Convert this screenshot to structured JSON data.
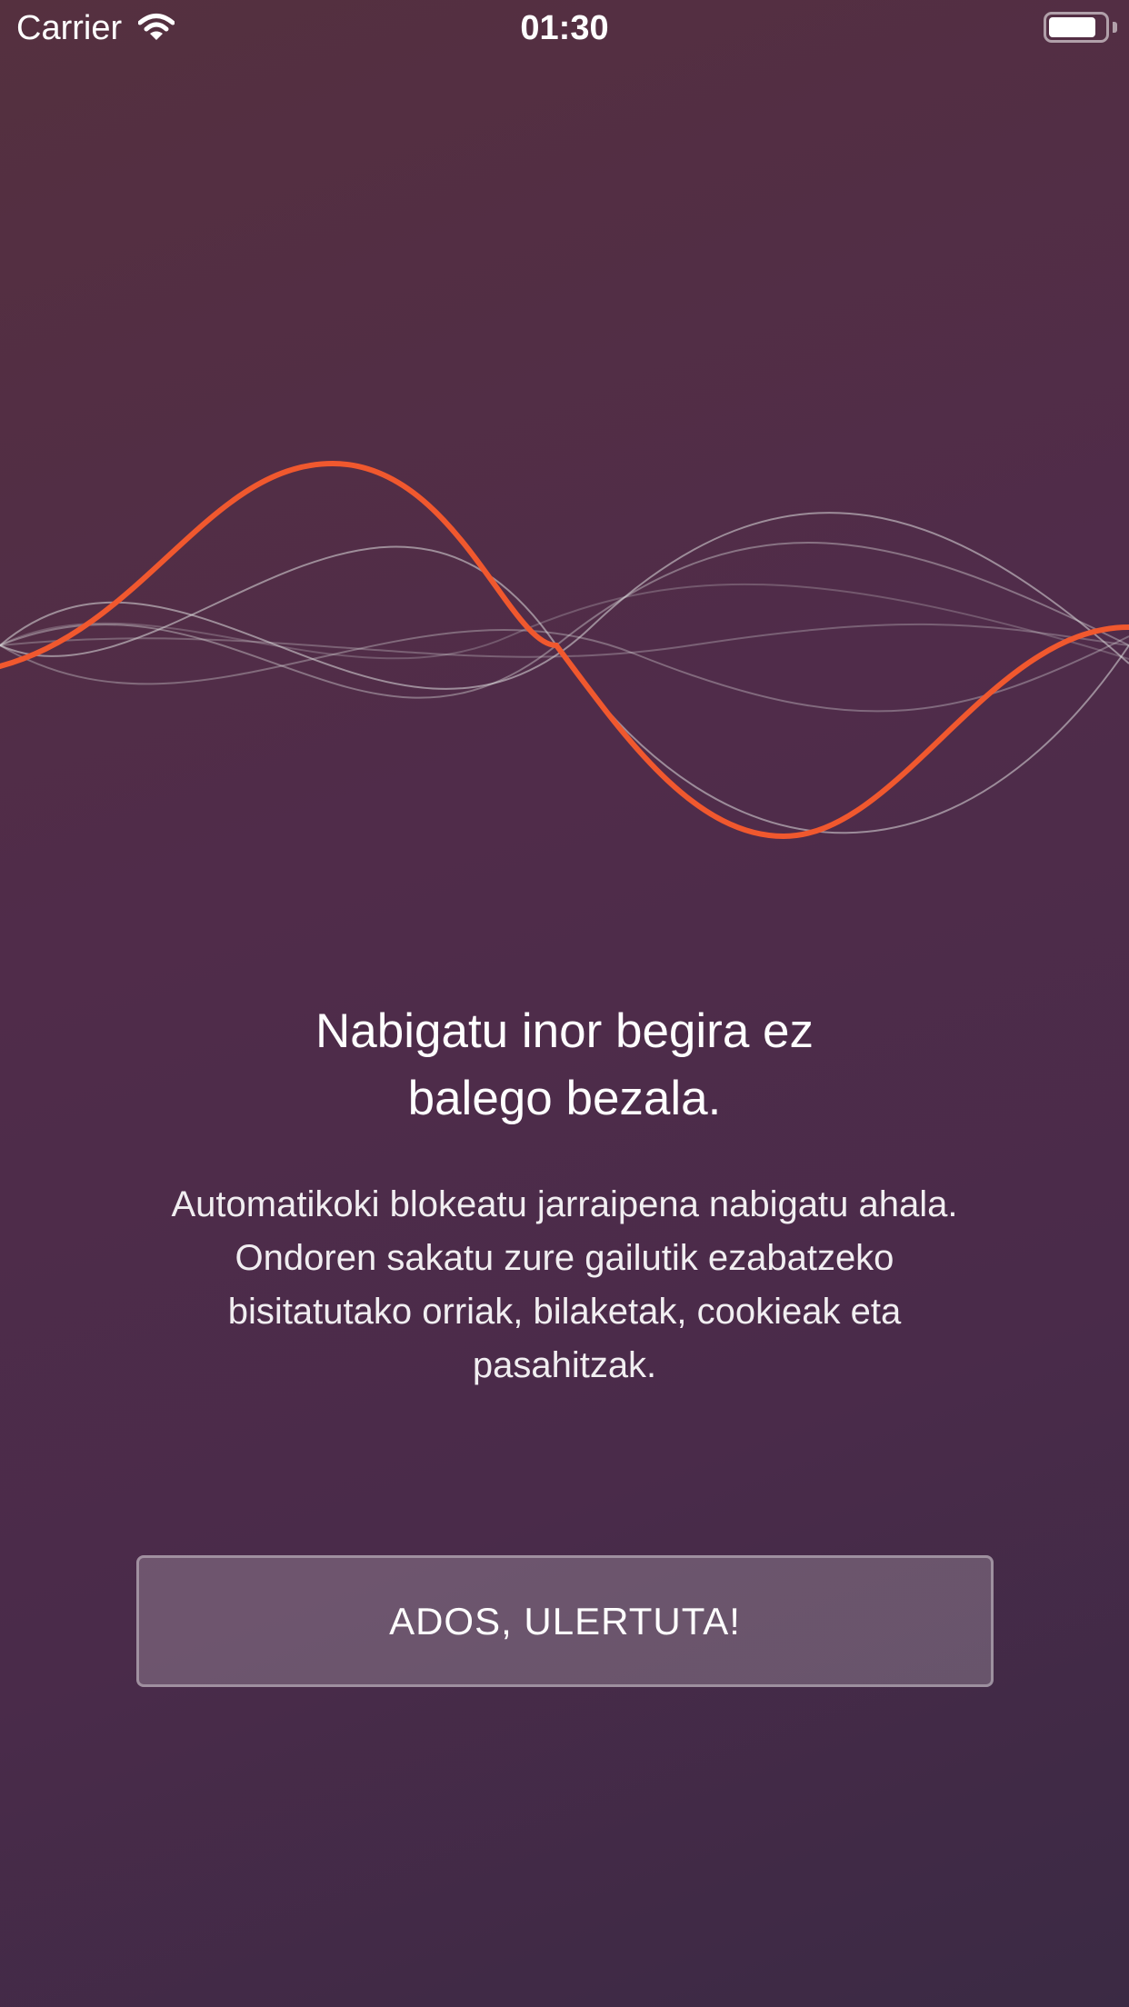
{
  "status_bar": {
    "carrier": "Carrier",
    "time": "01:30",
    "battery_level": 0.85
  },
  "onboarding": {
    "headline_line1": "Nabigatu inor begira ez",
    "headline_line2": "balego bezala.",
    "description_line1": "Automatikoki blokeatu jarraipena nabigatu ahala.",
    "description_line2": "Ondoren sakatu zure gailutik ezabatzeko",
    "description_line3": "bisitatutako orriak, bilaketak, cookieak eta",
    "description_line4": "pasahitzak.",
    "button_label": "ADOS, ULERTUTA!"
  },
  "colors": {
    "accent_wave": "#f0582e",
    "background_top": "#55303f",
    "background_bottom": "#3b2a44"
  },
  "icons": [
    "wifi-icon",
    "battery-icon"
  ]
}
